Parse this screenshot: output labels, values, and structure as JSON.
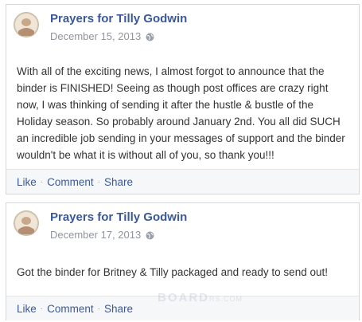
{
  "posts": [
    {
      "author": "Prayers for Tilly Godwin",
      "date": "December 15, 2013",
      "privacy_icon": "globe-icon",
      "body": "With all of the exciting news, I almost forgot to announce that the binder is FINISHED! Seeing as though post offices are crazy right now, I was thinking of sending it after the hustle & bustle of the Holiday season. So probably around January 2nd. You all did SUCH an incredible job sending in your messages of support and the binder wouldn't be what it is without all of you, so thank you!!!",
      "actions": {
        "like": "Like",
        "comment": "Comment",
        "share": "Share"
      }
    },
    {
      "author": "Prayers for Tilly Godwin",
      "date": "December 17, 2013",
      "privacy_icon": "globe-icon",
      "body": "Got the binder for Britney & Tilly packaged and ready to send out!",
      "actions": {
        "like": "Like",
        "comment": "Comment",
        "share": "Share"
      }
    }
  ],
  "separator": "·",
  "watermark": {
    "text": "BOARD",
    "small": "RS.COM"
  },
  "colors": {
    "link": "#3b5998",
    "meta": "#90949c",
    "text": "#333333",
    "action_bar": "#f6f7f9"
  }
}
